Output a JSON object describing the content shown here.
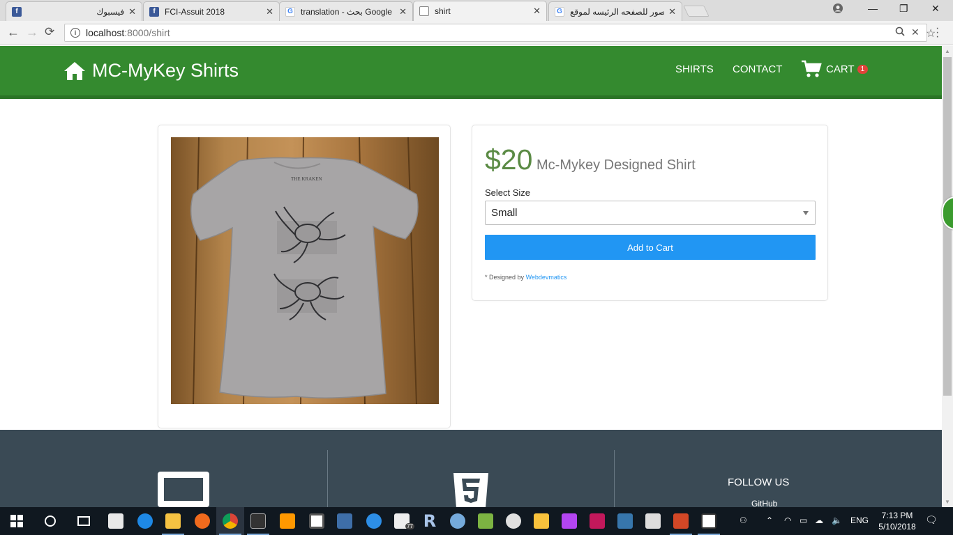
{
  "browser": {
    "tabs": [
      {
        "title": "فيسبوك",
        "favicon": "facebook-icon",
        "color": "#3b5998",
        "active": false
      },
      {
        "title": "FCI-Assuit 2018",
        "favicon": "facebook-icon",
        "color": "#3b5998",
        "active": false
      },
      {
        "title": "translation - بحث Google",
        "favicon": "google-icon",
        "color": "#4285f4",
        "active": false
      },
      {
        "title": "shirt",
        "favicon": "page-icon",
        "color": "#777777",
        "active": true
      },
      {
        "title": "صور للصفحه الرئيسه لموقع",
        "favicon": "google-icon",
        "color": "#4285f4",
        "active": false
      }
    ],
    "url_host": "localhost",
    "url_path": ":8000/shirt"
  },
  "navbar": {
    "brand": "MC-MyKey Shirts",
    "links": [
      "SHIRTS",
      "CONTACT"
    ],
    "cart_label": "CART",
    "cart_count": "1",
    "color": "#348a2f"
  },
  "product": {
    "price": "$20",
    "name": "Mc-Mykey Designed Shirt",
    "size_label": "Select Size",
    "size_selected": "Small",
    "add_button": "Add to Cart",
    "credit_prefix": "* Designed by",
    "credit_link": "Webdevmatics",
    "accent": "#2196f3"
  },
  "footer": {
    "follow_heading": "FOLLOW US",
    "github": "GitHub"
  },
  "taskbar": {
    "apps": [
      "start",
      "search",
      "task-view",
      "store",
      "edge",
      "file-explorer",
      "firefox",
      "chrome",
      "terminal",
      "sublime",
      "visual-studio",
      "mysql-workbench",
      "sourcetree",
      "mail",
      "r",
      "rstudio",
      "notepad",
      "paint",
      "beer",
      "phpstorm",
      "mc",
      "python",
      "heidi",
      "powerpoint",
      "photos"
    ],
    "badge_count": "77",
    "language": "ENG",
    "time": "7:13 PM",
    "date": "5/10/2018"
  }
}
